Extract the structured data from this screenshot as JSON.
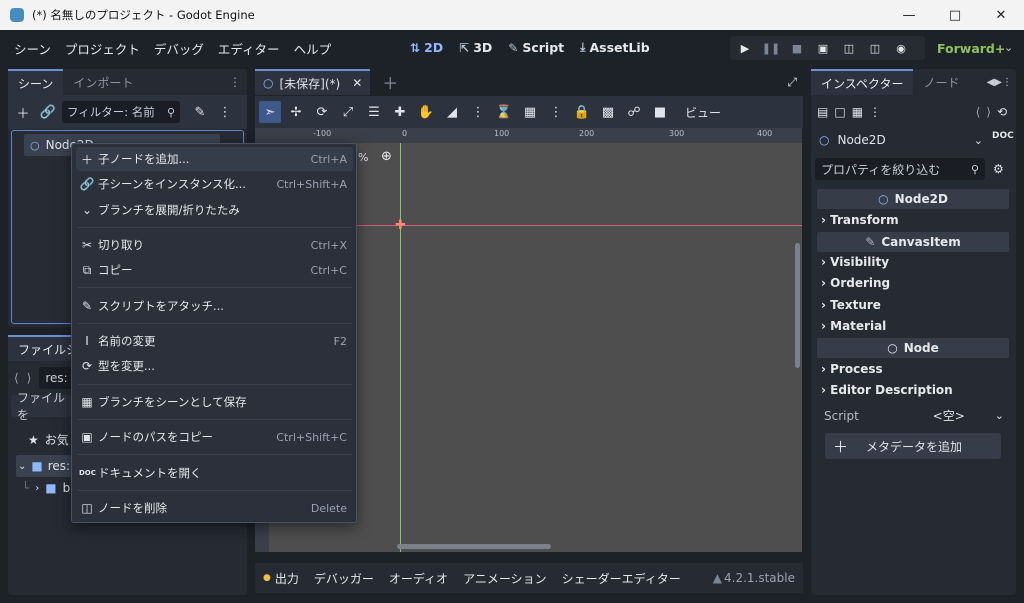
{
  "window": {
    "title": "(*) 名無しのプロジェクト - Godot Engine"
  },
  "menu": [
    "シーン",
    "プロジェクト",
    "デバッグ",
    "エディター",
    "ヘルプ"
  ],
  "workspaces": [
    {
      "label": "2D",
      "icon": "2d-icon"
    },
    {
      "label": "3D",
      "icon": "3d-icon"
    },
    {
      "label": "Script",
      "icon": "script-icon"
    },
    {
      "label": "AssetLib",
      "icon": "assetlib-icon"
    }
  ],
  "renderer": "Forward+",
  "scene_dock": {
    "tabs": [
      "シーン",
      "インポート"
    ],
    "filter_placeholder": "フィルター: 名前",
    "root_node": "Node2D"
  },
  "filesystem_dock": {
    "title": "ファイルシ",
    "path": "res:",
    "filter": "ファイルを",
    "favorites": "お気",
    "tree_root": "res:",
    "tree_child": "bi"
  },
  "editor_tab": {
    "label": "[未保存](*)"
  },
  "viewport": {
    "view_label": "ビュー",
    "zoom_suffix": "%",
    "ruler": [
      "-100",
      "0",
      "100",
      "200",
      "300",
      "400"
    ]
  },
  "context_menu": [
    {
      "icon": "add-icon",
      "label": "子ノードを追加...",
      "shortcut": "Ctrl+A"
    },
    {
      "icon": "link-icon",
      "label": "子シーンをインスタンス化...",
      "shortcut": "Ctrl+Shift+A"
    },
    {
      "icon": "chevron-down-icon",
      "label": "ブランチを展開/折りたたみ",
      "shortcut": ""
    },
    {
      "icon": "scissors-icon",
      "label": "切り取り",
      "shortcut": "Ctrl+X"
    },
    {
      "icon": "copy-icon",
      "label": "コピー",
      "shortcut": "Ctrl+C"
    },
    {
      "icon": "script-attach-icon",
      "label": "スクリプトをアタッチ...",
      "shortcut": ""
    },
    {
      "icon": "rename-icon",
      "label": "名前の変更",
      "shortcut": "F2"
    },
    {
      "icon": "change-type-icon",
      "label": "型を変更...",
      "shortcut": ""
    },
    {
      "icon": "save-branch-icon",
      "label": "ブランチをシーンとして保存",
      "shortcut": ""
    },
    {
      "icon": "copy-path-icon",
      "label": "ノードのパスをコピー",
      "shortcut": "Ctrl+Shift+C"
    },
    {
      "icon": "doc-icon",
      "label": "ドキュメントを開く",
      "shortcut": ""
    },
    {
      "icon": "trash-icon",
      "label": "ノードを削除",
      "shortcut": "Delete"
    }
  ],
  "inspector": {
    "tabs": [
      "インスペクター",
      "ノード"
    ],
    "node_selector": "Node2D",
    "filter_placeholder": "プロパティを絞り込む",
    "sections": {
      "node2d": "Node2D",
      "canvasitem": "CanvasItem",
      "node": "Node"
    },
    "categories": {
      "transform": "Transform",
      "visibility": "Visibility",
      "ordering": "Ordering",
      "texture": "Texture",
      "material": "Material",
      "process": "Process",
      "editor_description": "Editor Description"
    },
    "script_label": "Script",
    "script_value": "<空>",
    "add_metadata": "メタデータを追加"
  },
  "bottom_panel": {
    "tabs": [
      "出力",
      "デバッガー",
      "オーディオ",
      "アニメーション",
      "シェーダーエディター"
    ],
    "version": "4.2.1.stable"
  },
  "colors": {
    "accent": "#8fb8ff",
    "renderer": "#8fc15e",
    "axis_x": "#d45b7a",
    "axis_y": "#8fc15e"
  }
}
